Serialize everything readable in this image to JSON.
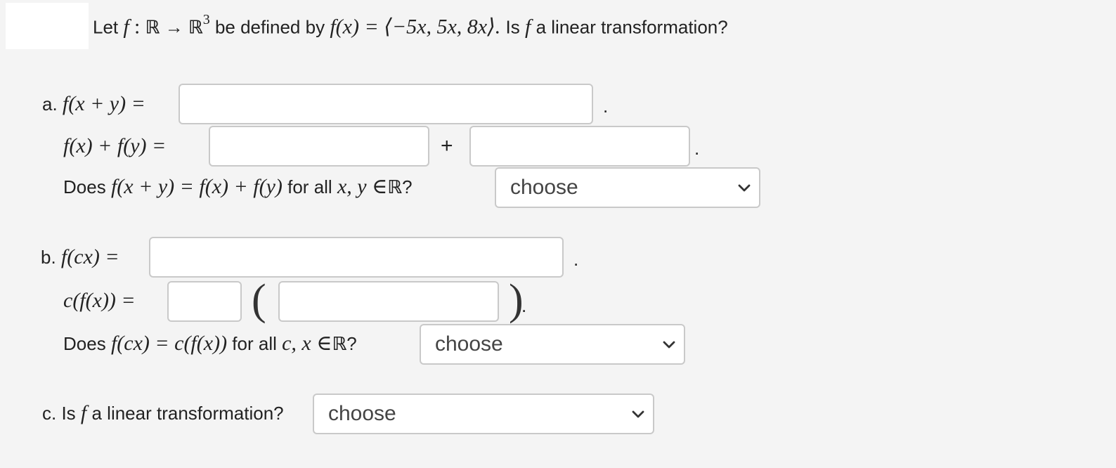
{
  "question": {
    "let": "Let",
    "f": "f",
    "colon": ":",
    "R": "ℝ",
    "arrow": "→",
    "R3": "ℝ",
    "exp": "3",
    "defined_by": "be defined by",
    "expr": "f(x) = ⟨−5x, 5x, 8x⟩.",
    "is": "Is",
    "tail": "a linear transformation?"
  },
  "part_a": {
    "label": "a.",
    "lhs1": "f(x + y) =",
    "period1": ".",
    "lhs2": "f(x) + f(y) =",
    "plus": "+",
    "period2": ".",
    "does": "Does",
    "eq": "f(x + y) = f(x) + f(y)",
    "for_all": "for all",
    "vars": "x, y ∈",
    "R": "ℝ",
    "qmark": "?",
    "select_value": "choose",
    "input1": "",
    "input2": "",
    "input3": ""
  },
  "part_b": {
    "label": "b.",
    "lhs1": "f(cx) =",
    "period1": ".",
    "lhs2": "c(f(x)) =",
    "lparen": "(",
    "rparen": ")",
    "period2": ".",
    "does": "Does",
    "eq": "f(cx) = c(f(x))",
    "for_all": "for all",
    "vars": "c, x ∈",
    "R": "ℝ",
    "qmark": "?",
    "select_value": "choose",
    "input1": "",
    "input2": "",
    "input3": ""
  },
  "part_c": {
    "label": "c. Is",
    "f": "f",
    "tail": "a linear transformation?",
    "select_value": "choose"
  },
  "colors": {
    "background": "#f4f4f4",
    "input_border": "#c9c9c9",
    "chevron": "#333333"
  },
  "icons": {
    "dropdown": "chevron-down-icon"
  }
}
